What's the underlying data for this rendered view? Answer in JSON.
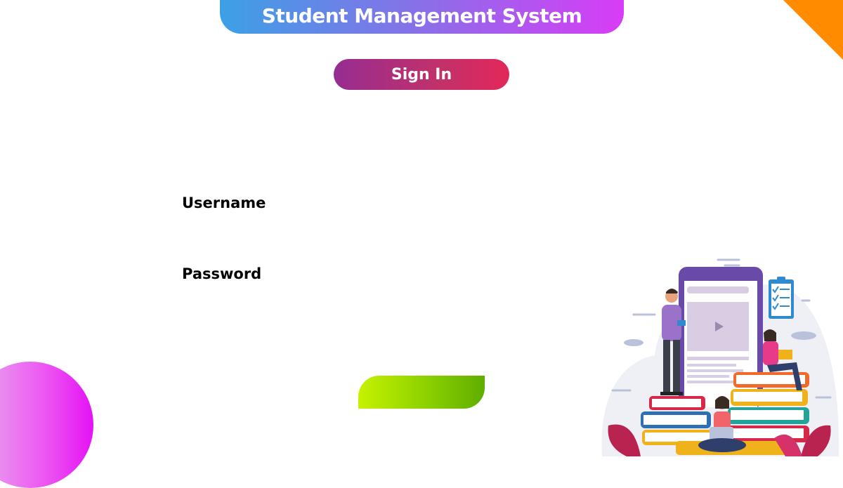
{
  "header": {
    "title": "Student Management System"
  },
  "signin_badge": {
    "label": "Sign In"
  },
  "form": {
    "username_label": "Username",
    "password_label": "Password",
    "username_value": "",
    "password_value": ""
  },
  "colors": {
    "banner_start": "#3ca0e6",
    "banner_end": "#d83cf7",
    "signin_start": "#962d91",
    "signin_end": "#e2285a",
    "submit_start": "#c6f200",
    "submit_end": "#5fae00",
    "corner_accent": "#ff8c00",
    "circle_accent": "#e512f5"
  },
  "illustration": {
    "icon": "students-books-phone-illustration"
  }
}
